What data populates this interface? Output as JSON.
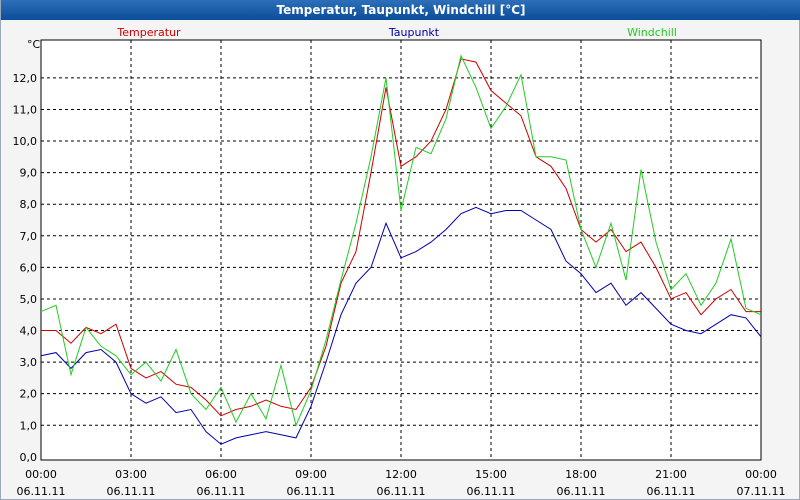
{
  "window": {
    "title": "Temperatur, Taupunkt, Windchill [°C]"
  },
  "chart_data": {
    "type": "line",
    "title": "Temperatur, Taupunkt, Windchill [°C]",
    "ylabel": "°C",
    "xlabel": "",
    "ylim": [
      -0.1,
      13.2
    ],
    "xlim": [
      0,
      24
    ],
    "grid": true,
    "legend": "top",
    "y_ticks": [
      {
        "value": 0,
        "label": "0,0"
      },
      {
        "value": 1,
        "label": "1,0"
      },
      {
        "value": 2,
        "label": "2,0"
      },
      {
        "value": 3,
        "label": "3,0"
      },
      {
        "value": 4,
        "label": "4,0"
      },
      {
        "value": 5,
        "label": "5,0"
      },
      {
        "value": 6,
        "label": "6,0"
      },
      {
        "value": 7,
        "label": "7,0"
      },
      {
        "value": 8,
        "label": "8,0"
      },
      {
        "value": 9,
        "label": "9,0"
      },
      {
        "value": 10,
        "label": "10,0"
      },
      {
        "value": 11,
        "label": "11,0"
      },
      {
        "value": 12,
        "label": "12,0"
      }
    ],
    "x_ticks": [
      {
        "value": 0,
        "time": "00:00",
        "date": "06.11.11"
      },
      {
        "value": 3,
        "time": "03:00",
        "date": "06.11.11"
      },
      {
        "value": 6,
        "time": "06:00",
        "date": "06.11.11"
      },
      {
        "value": 9,
        "time": "09:00",
        "date": "06.11.11"
      },
      {
        "value": 12,
        "time": "12:00",
        "date": "06.11.11"
      },
      {
        "value": 15,
        "time": "15:00",
        "date": "06.11.11"
      },
      {
        "value": 18,
        "time": "18:00",
        "date": "06.11.11"
      },
      {
        "value": 21,
        "time": "21:00",
        "date": "06.11.11"
      },
      {
        "value": 24,
        "time": "00:00",
        "date": "07.11.11"
      }
    ],
    "x": [
      0,
      0.5,
      1,
      1.5,
      2,
      2.5,
      3,
      3.5,
      4,
      4.5,
      5,
      5.5,
      6,
      6.5,
      7,
      7.5,
      8,
      8.5,
      9,
      9.5,
      10,
      10.5,
      11,
      11.5,
      12,
      12.5,
      13,
      13.5,
      14,
      14.5,
      15,
      15.5,
      16,
      16.5,
      17,
      17.5,
      18,
      18.5,
      19,
      19.5,
      20,
      20.5,
      21,
      21.5,
      22,
      22.5,
      23,
      23.5,
      24
    ],
    "series": [
      {
        "name": "Temperatur",
        "color": "#cc0000",
        "values": [
          4.0,
          4.0,
          3.6,
          4.1,
          3.9,
          4.2,
          2.8,
          2.5,
          2.7,
          2.3,
          2.2,
          1.8,
          1.3,
          1.5,
          1.6,
          1.8,
          1.6,
          1.5,
          2.2,
          3.5,
          5.5,
          6.5,
          9.0,
          11.7,
          9.2,
          9.5,
          10.0,
          11.0,
          12.6,
          12.5,
          11.6,
          11.2,
          10.8,
          9.5,
          9.2,
          8.5,
          7.2,
          6.8,
          7.2,
          6.5,
          6.8,
          6.0,
          5.0,
          5.2,
          4.5,
          5.0,
          5.3,
          4.6,
          4.6
        ]
      },
      {
        "name": "Taupunkt",
        "color": "#0000aa",
        "values": [
          3.2,
          3.3,
          2.8,
          3.3,
          3.4,
          3.0,
          2.0,
          1.7,
          1.9,
          1.4,
          1.5,
          0.8,
          0.4,
          0.6,
          0.7,
          0.8,
          0.7,
          0.6,
          1.6,
          3.0,
          4.5,
          5.5,
          6.0,
          7.4,
          6.3,
          6.5,
          6.8,
          7.2,
          7.7,
          7.9,
          7.7,
          7.8,
          7.8,
          7.5,
          7.2,
          6.2,
          5.8,
          5.2,
          5.5,
          4.8,
          5.2,
          4.7,
          4.2,
          4.0,
          3.9,
          4.2,
          4.5,
          4.4,
          3.8
        ]
      },
      {
        "name": "Windchill",
        "color": "#22cc22",
        "values": [
          4.6,
          4.8,
          2.6,
          4.1,
          3.5,
          3.2,
          2.6,
          3.0,
          2.4,
          3.4,
          2.0,
          1.5,
          2.2,
          1.1,
          2.0,
          1.2,
          2.9,
          1.0,
          2.1,
          3.7,
          5.6,
          7.4,
          9.5,
          12.0,
          7.8,
          9.8,
          9.6,
          10.7,
          12.7,
          11.7,
          10.4,
          11.1,
          12.1,
          9.5,
          9.5,
          9.4,
          7.2,
          6.0,
          7.4,
          5.6,
          9.1,
          6.8,
          5.3,
          5.8,
          4.8,
          5.5,
          6.9,
          4.7,
          4.5
        ]
      }
    ]
  }
}
